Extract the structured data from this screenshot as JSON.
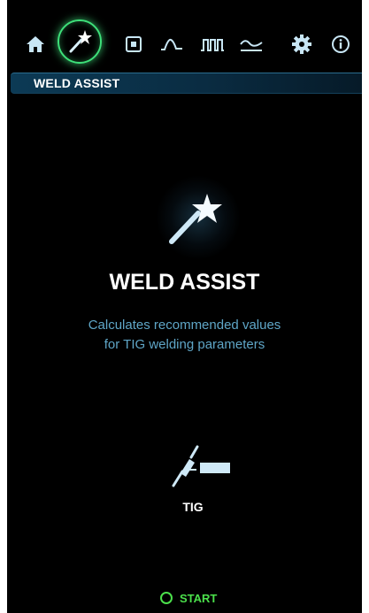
{
  "nav": {
    "icons": [
      {
        "name": "home-icon",
        "active": false
      },
      {
        "name": "weld-assist-wand-icon",
        "active": true
      },
      {
        "name": "memory-square-icon",
        "active": false
      },
      {
        "name": "pulse-waveform-icon",
        "active": false
      },
      {
        "name": "square-wave-icon",
        "active": false
      },
      {
        "name": "ac-wave-icon",
        "active": false
      },
      {
        "name": "gear-icon",
        "active": false
      },
      {
        "name": "info-icon",
        "active": false
      }
    ]
  },
  "section": {
    "title": "WELD ASSIST"
  },
  "hero": {
    "title": "WELD ASSIST",
    "description_line1": "Calculates recommended values",
    "description_line2": "for TIG welding parameters"
  },
  "process": {
    "label": "TIG"
  },
  "action": {
    "start_label": "START"
  },
  "colors": {
    "background": "#000000",
    "accent_green": "#4be04b",
    "active_ring": "#3ee07a",
    "text_blue": "#5fa6c7",
    "icon_blue": "#bfe3f5",
    "header_bar": "#0c3a55"
  }
}
